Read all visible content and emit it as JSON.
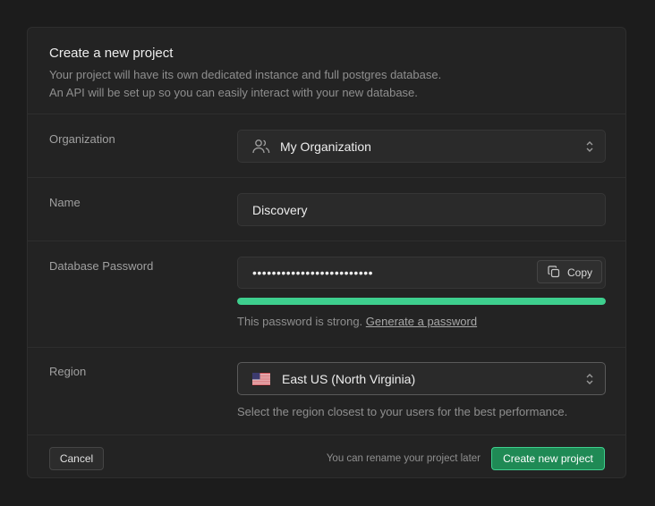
{
  "dialog": {
    "title": "Create a new project",
    "description_line1": "Your project will have its own dedicated instance and full postgres database.",
    "description_line2": "An API will be set up so you can easily interact with your new database."
  },
  "organization": {
    "label": "Organization",
    "value": "My Organization",
    "icon": "users-icon"
  },
  "name": {
    "label": "Name",
    "value": "Discovery"
  },
  "password": {
    "label": "Database Password",
    "value": "•••••••••••••••••••••••••",
    "copy_label": "Copy",
    "strength_percent": 100,
    "strength_text": "This password is strong.",
    "generate_link": "Generate a password"
  },
  "region": {
    "label": "Region",
    "value": "East US (North Virginia)",
    "flag": "us-flag-icon",
    "hint": "Select the region closest to your users for the best performance."
  },
  "footer": {
    "cancel_label": "Cancel",
    "note": "You can rename your project later",
    "create_label": "Create new project"
  },
  "colors": {
    "accent": "#3ecf8e",
    "background": "#1c1c1c",
    "card": "#232323"
  }
}
